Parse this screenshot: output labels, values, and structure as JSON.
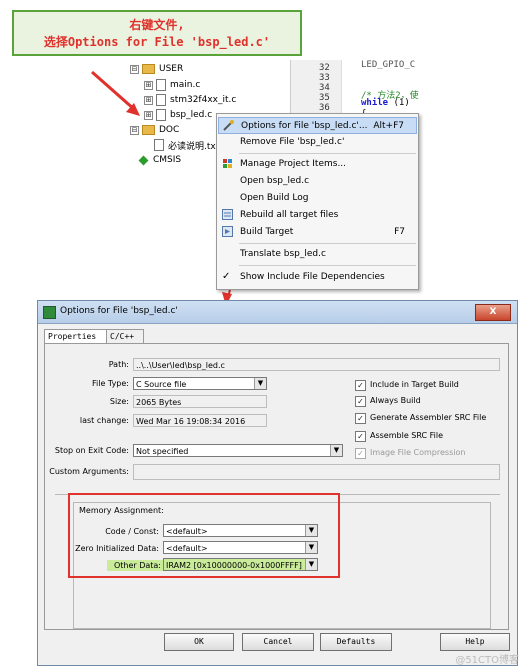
{
  "callout": {
    "line1": "右键文件,",
    "line2": "选择Options for File 'bsp_led.c'"
  },
  "tree": {
    "items": [
      {
        "label": "USER",
        "type": "folder",
        "expander": "⊟"
      },
      {
        "label": "main.c",
        "type": "file",
        "expander": "⊞"
      },
      {
        "label": "stm32f4xx_it.c",
        "type": "file",
        "expander": "⊞"
      },
      {
        "label": "bsp_led.c",
        "type": "file",
        "expander": "⊞"
      },
      {
        "label": "DOC",
        "type": "folder",
        "expander": "⊟"
      },
      {
        "label": "必读说明.txt",
        "type": "file",
        "expander": ""
      },
      {
        "label": "CMSIS",
        "type": "component",
        "expander": ""
      }
    ]
  },
  "code": {
    "line_numbers": [
      "32",
      "33",
      "34",
      "35",
      "36",
      "37"
    ],
    "line1": "LED_GPIO_C",
    "comment": "/* 方法2，使",
    "while_kw": "while",
    "while_rest": " (1)",
    "brace": "{"
  },
  "context_menu": {
    "items": [
      {
        "label": "Options for File 'bsp_led.c'...",
        "shortcut": "Alt+F7",
        "selected": true
      },
      {
        "label": "Remove File 'bsp_led.c'",
        "shortcut": ""
      },
      {
        "label": "Manage Project Items...",
        "shortcut": ""
      },
      {
        "label": "Open bsp_led.c",
        "shortcut": ""
      },
      {
        "label": "Open Build Log",
        "shortcut": ""
      },
      {
        "label": "Rebuild all target files",
        "shortcut": ""
      },
      {
        "label": "Build Target",
        "shortcut": "F7"
      },
      {
        "label": "Translate bsp_led.c",
        "shortcut": ""
      },
      {
        "label": "Show Include File Dependencies",
        "shortcut": "",
        "checked": true
      }
    ]
  },
  "dialog": {
    "title": "Options for File 'bsp_led.c'",
    "close_label": "X",
    "tabs": [
      "Properties",
      "C/C++"
    ],
    "path_label": "Path:",
    "path_value": "..\\..\\User\\led\\bsp_led.c",
    "file_type_label": "File Type:",
    "file_type_value": "C Source file",
    "size_label": "Size:",
    "size_value": "2065 Bytes",
    "last_change_label": "last change:",
    "last_change_value": "Wed Mar 16 19:08:34 2016",
    "stop_label": "Stop on Exit Code:",
    "stop_value": "Not specified",
    "custom_args_label": "Custom Arguments:",
    "custom_args_value": "",
    "checkboxes": [
      {
        "label": "Include in Target Build",
        "checked": true,
        "disabled": false
      },
      {
        "label": "Always Build",
        "checked": true,
        "disabled": false
      },
      {
        "label": "Generate Assembler SRC File",
        "checked": true,
        "disabled": false
      },
      {
        "label": "Assemble SRC File",
        "checked": true,
        "disabled": false
      },
      {
        "label": "Image File Compression",
        "checked": true,
        "disabled": true
      }
    ],
    "memory": {
      "title": "Memory Assignment:",
      "code_label": "Code / Const:",
      "code_value": "<default>",
      "zero_label": "Zero Initialized Data:",
      "zero_value": "<default>",
      "other_label": "Other Data:",
      "other_value": "IRAM2 [0x10000000-0x1000FFFF]"
    },
    "buttons": {
      "ok": "OK",
      "cancel": "Cancel",
      "defaults": "Defaults",
      "help": "Help"
    }
  },
  "watermark": "@51CTO博客",
  "colors": {
    "annotation": "#e0322c",
    "callout_border": "#5aa33a",
    "highlight": "#c8dcf5"
  }
}
